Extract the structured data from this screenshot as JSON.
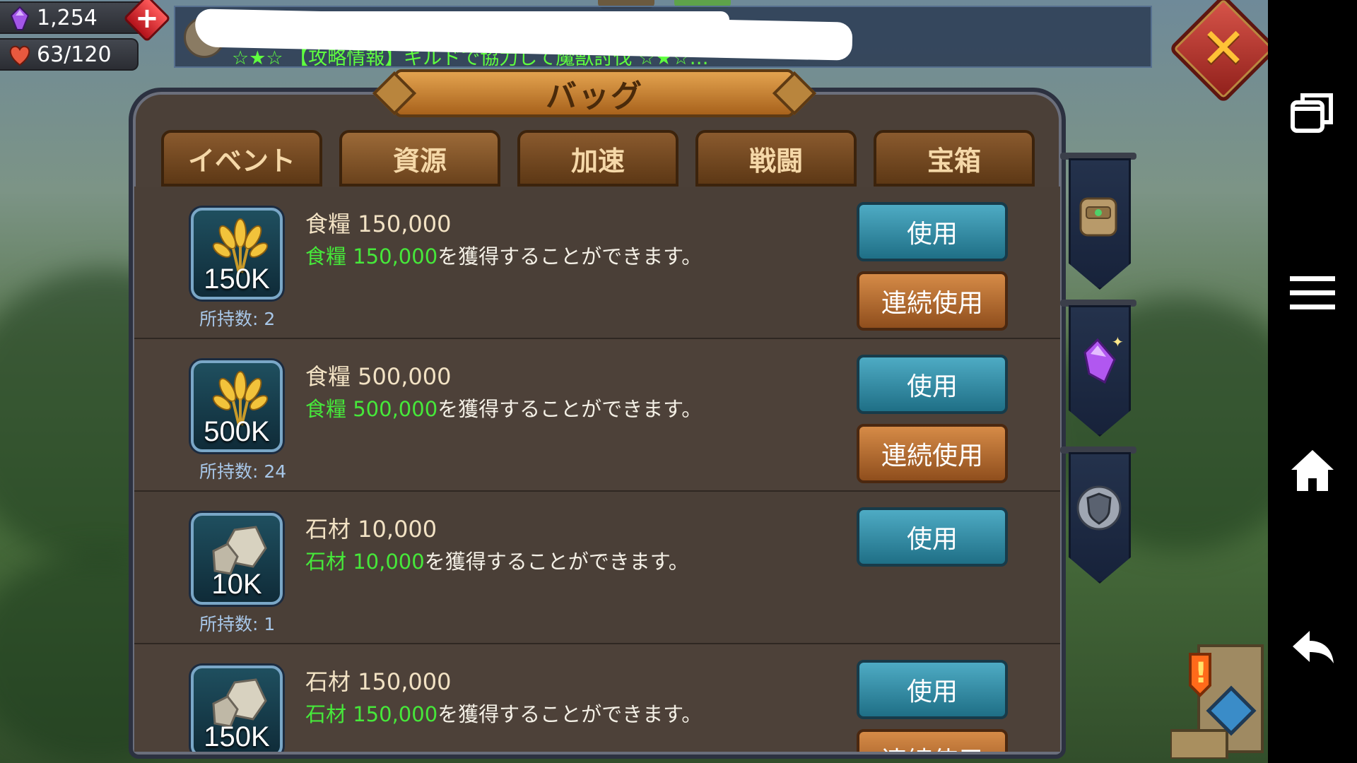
{
  "status": {
    "gems": "1,254",
    "stamina": "63/120"
  },
  "news": {
    "message": "☆★☆ 【攻略情報】ギルドで協力して魔獣討伐 ☆★☆…"
  },
  "panel": {
    "title": "バッグ",
    "tabs": [
      "イベント",
      "資源",
      "加速",
      "戦闘",
      "宝箱"
    ]
  },
  "items": [
    {
      "icon": "wheat-icon",
      "badge": "150K",
      "owned": "所持数: 2",
      "name": "食糧 150,000",
      "desc_highlight": "食糧 150,000",
      "desc_rest": "を獲得することができます。",
      "use_label": "使用",
      "multi_label": "連続使用"
    },
    {
      "icon": "wheat-icon",
      "badge": "500K",
      "owned": "所持数: 24",
      "name": "食糧 500,000",
      "desc_highlight": "食糧 500,000",
      "desc_rest": "を獲得することができます。",
      "use_label": "使用",
      "multi_label": "連続使用"
    },
    {
      "icon": "stone-icon",
      "badge": "10K",
      "owned": "所持数: 1",
      "name": "石材 10,000",
      "desc_highlight": "石材 10,000",
      "desc_rest": "を獲得することができます。",
      "use_label": "使用"
    },
    {
      "icon": "stone-icon",
      "badge": "150K",
      "name": "石材 150,000",
      "desc_highlight": "石材 150,000",
      "desc_rest": "を獲得することができます。",
      "use_label": "使用",
      "multi_label": "連続使用"
    }
  ],
  "side_categories": [
    "backpack-icon",
    "gem-icon",
    "shield-icon"
  ],
  "colors": {
    "highlight_green": "#46e83a",
    "owned_blue": "#a8c7e8",
    "use_button": "#2f8ea8",
    "multi_button": "#b06a2f"
  }
}
